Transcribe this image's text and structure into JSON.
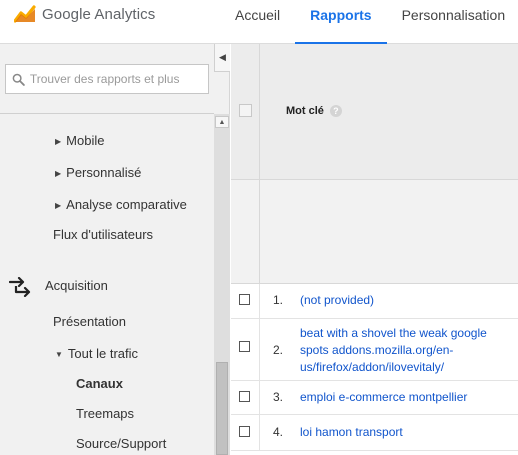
{
  "app": {
    "name": "Google Analytics"
  },
  "nav": {
    "tabs": [
      "Accueil",
      "Rapports",
      "Personnalisation"
    ],
    "active_index": 1
  },
  "search": {
    "placeholder": "Trouver des rapports et plus"
  },
  "sidebar": {
    "items": {
      "mobile": "Mobile",
      "personnalise": "Personnalisé",
      "analyse_comparative": "Analyse comparative",
      "flux_utilisateurs": "Flux d'utilisateurs",
      "acquisition": "Acquisition",
      "presentation": "Présentation",
      "tout_le_trafic": "Tout le trafic",
      "canaux": "Canaux",
      "treemaps": "Treemaps",
      "source_support": "Source/Support"
    }
  },
  "table": {
    "column_header": "Mot clé",
    "help_glyph": "?",
    "rows": [
      {
        "num": "1.",
        "keyword": "(not provided)"
      },
      {
        "num": "2.",
        "keyword": "beat with a shovel the weak google spots addons.mozilla.org/en-us/firefox/addon/ilovevitaly/"
      },
      {
        "num": "3.",
        "keyword": "emploi e-commerce montpellier"
      },
      {
        "num": "4.",
        "keyword": "loi hamon transport"
      }
    ]
  },
  "colors": {
    "accent": "#1a73e8",
    "link": "#1155cc",
    "logo_orange": "#f9ab00",
    "logo_dark_orange": "#e37400"
  }
}
